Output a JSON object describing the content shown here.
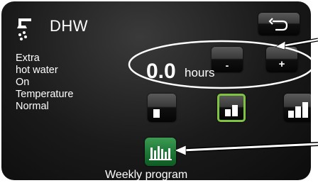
{
  "header": {
    "title": "DHW",
    "icon": "shower-tap-icon"
  },
  "status": {
    "line1": "Extra",
    "line2": "hot water",
    "line3": "On",
    "line4": "Temperature",
    "line5": "Normal"
  },
  "extra_hot_water": {
    "value": "0.0",
    "unit": "hours",
    "minus_label": "-",
    "plus_label": "+"
  },
  "temperature_levels": {
    "options": [
      "low",
      "normal",
      "high"
    ],
    "selected": "normal",
    "selected_color": "#7fc341"
  },
  "weekly_program": {
    "label": "Weekly program",
    "button_color": "#1f7a38"
  },
  "navigation": {
    "back_icon": "back-arrow-icon"
  }
}
